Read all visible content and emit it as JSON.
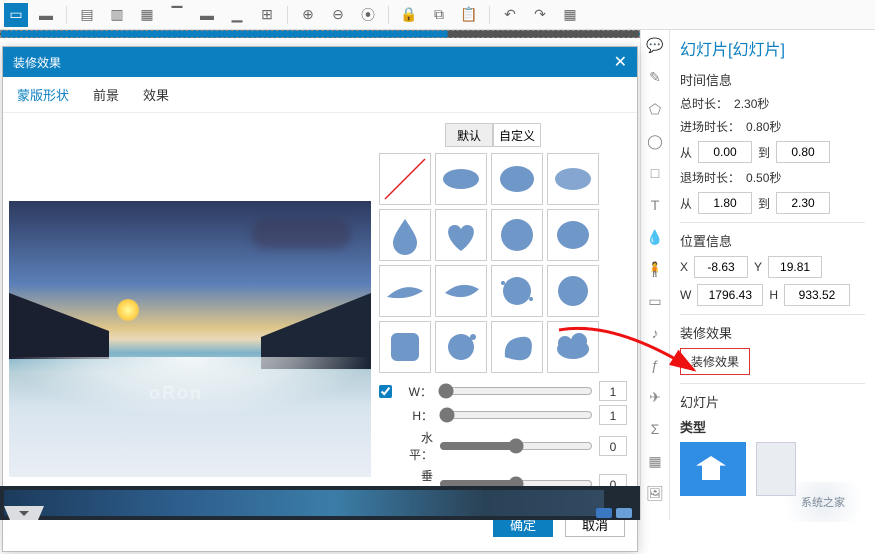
{
  "toolbar_icons": [
    "edit",
    "row",
    "align-l",
    "align-c",
    "align-r",
    "align-t",
    "align-m",
    "align-b",
    "dist",
    "zoom-in",
    "zoom-out",
    "reset-zoom",
    "lock",
    "copy",
    "paste",
    "undo",
    "redo",
    "slides"
  ],
  "dialog": {
    "title": "装修效果",
    "tabs": [
      "蒙版形状",
      "前景",
      "效果"
    ],
    "active_tab": 0,
    "shape_tabs": [
      "默认",
      "自定义"
    ],
    "active_shape_tab": 0,
    "lock_wh": true,
    "sliders": {
      "W": "1",
      "H": "1",
      "水平": "0",
      "垂直": "0"
    },
    "buttons": {
      "ok": "确定",
      "cancel": "取消"
    }
  },
  "rail_icons": [
    "chat",
    "pencil",
    "pentagon",
    "ring",
    "square",
    "T",
    "drop",
    "figurine",
    "folder",
    "music",
    "flash",
    "plane",
    "sigma",
    "calendar",
    "image"
  ],
  "right": {
    "title": "幻灯片[幻灯片]",
    "s_time": "时间信息",
    "total_label": "总时长：",
    "total": "2.30秒",
    "enter_label": "进场时长：",
    "enter": "0.80秒",
    "from": "从",
    "to": "到",
    "t1a": "0.00",
    "t1b": "0.80",
    "exit_label": "退场时长：",
    "exit": "0.50秒",
    "t2a": "1.80",
    "t2b": "2.30",
    "s_pos": "位置信息",
    "x_lbl": "X",
    "y_lbl": "Y",
    "w_lbl": "W",
    "h_lbl": "H",
    "x": "-8.63",
    "y": "19.81",
    "w": "1796.43",
    "h": "933.52",
    "s_eff": "装修效果",
    "eff_btn": "装修效果",
    "s_slide": "幻灯片",
    "s_type": "类型"
  },
  "watermark": "系统之家"
}
